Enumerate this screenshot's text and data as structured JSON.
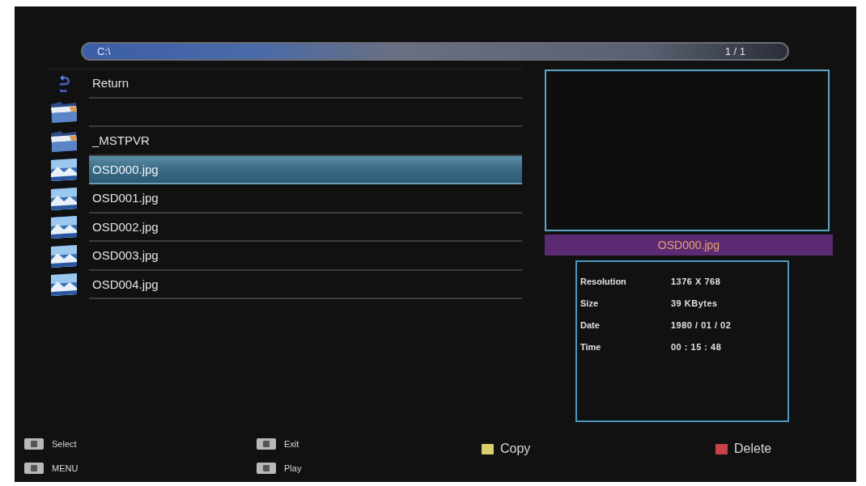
{
  "path_bar": {
    "path": "C:\\",
    "page": "1 / 1"
  },
  "files": [
    {
      "kind": "return",
      "name": "Return",
      "selected": false
    },
    {
      "kind": "folder",
      "selected": false
    },
    {
      "kind": "folder",
      "name": "_MSTPVR",
      "selected": false
    },
    {
      "kind": "image",
      "name": "OSD000.jpg",
      "selected": true
    },
    {
      "kind": "image",
      "name": "OSD001.jpg",
      "selected": false
    },
    {
      "kind": "image",
      "name": "OSD002.jpg",
      "selected": false
    },
    {
      "kind": "image",
      "name": "OSD003.jpg",
      "selected": false
    },
    {
      "kind": "image",
      "name": "OSD004.jpg",
      "selected": false
    }
  ],
  "preview": {
    "filename": "OSD000.jpg"
  },
  "info": [
    {
      "label": "Resolution",
      "value": "1376 X 768"
    },
    {
      "label": "Size",
      "value": "39 KBytes"
    },
    {
      "label": "Date",
      "value": "1980 / 01 / 02"
    },
    {
      "label": "Time",
      "value": "00 : 15 : 48"
    }
  ],
  "hints": [
    [
      {
        "kind": "key",
        "label": "Select"
      },
      {
        "kind": "key",
        "label": "MENU"
      }
    ],
    [
      {
        "kind": "key",
        "label": "Exit"
      },
      {
        "kind": "key",
        "label": "Play"
      }
    ],
    [
      {
        "kind": "color_key",
        "color": "#d8cf6a",
        "label": "Copy"
      }
    ],
    [
      {
        "kind": "color_key",
        "color": "#c8404a",
        "label": "Delete"
      }
    ]
  ]
}
